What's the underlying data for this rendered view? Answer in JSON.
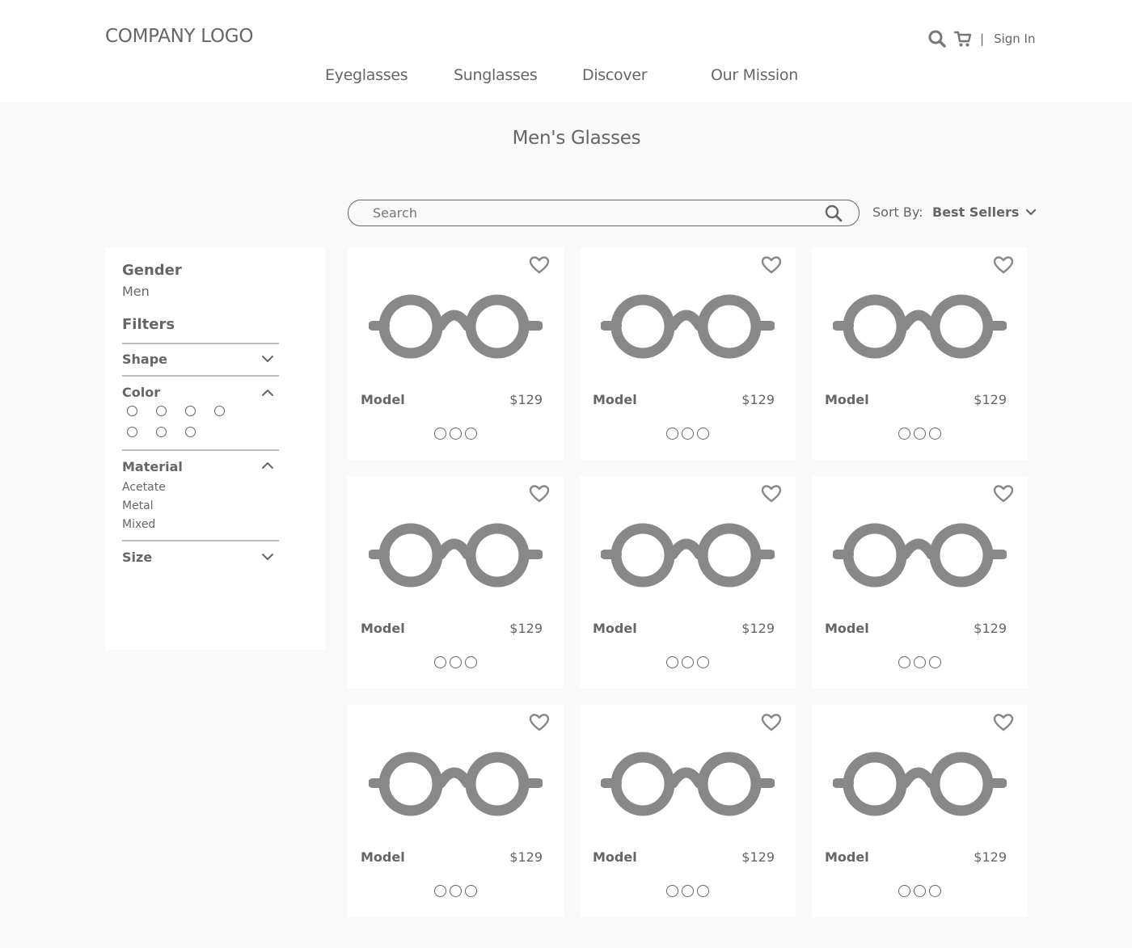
{
  "header": {
    "logo": "COMPANY LOGO",
    "separator": "|",
    "sign_in": "Sign In",
    "icons": [
      "search-icon",
      "cart-icon"
    ]
  },
  "nav": {
    "items": [
      {
        "label": "Eyeglasses"
      },
      {
        "label": "Sunglasses"
      },
      {
        "label": "Discover"
      },
      {
        "label": "Our Mission"
      }
    ]
  },
  "page": {
    "title": "Men's Glasses"
  },
  "search": {
    "placeholder": "Search"
  },
  "sort": {
    "label": "Sort By:",
    "value": "Best Sellers"
  },
  "sidebar": {
    "gender_heading": "Gender",
    "gender_value": "Men",
    "filters_heading": "Filters",
    "sections": {
      "shape": "Shape",
      "color": "Color",
      "material": "Material",
      "size": "Size"
    },
    "material_options": [
      "Acetate",
      "Metal",
      "Mixed"
    ],
    "color_swatch_count": 7
  },
  "products": [
    {
      "name": "Model",
      "price": "$129"
    },
    {
      "name": "Model",
      "price": "$129"
    },
    {
      "name": "Model",
      "price": "$129"
    },
    {
      "name": "Model",
      "price": "$129"
    },
    {
      "name": "Model",
      "price": "$129"
    },
    {
      "name": "Model",
      "price": "$129"
    },
    {
      "name": "Model",
      "price": "$129"
    },
    {
      "name": "Model",
      "price": "$129"
    },
    {
      "name": "Model",
      "price": "$129"
    }
  ],
  "colors": {
    "text": "#666666",
    "icon": "#888888",
    "background": "#f9f9f9",
    "panel": "#ffffff"
  }
}
